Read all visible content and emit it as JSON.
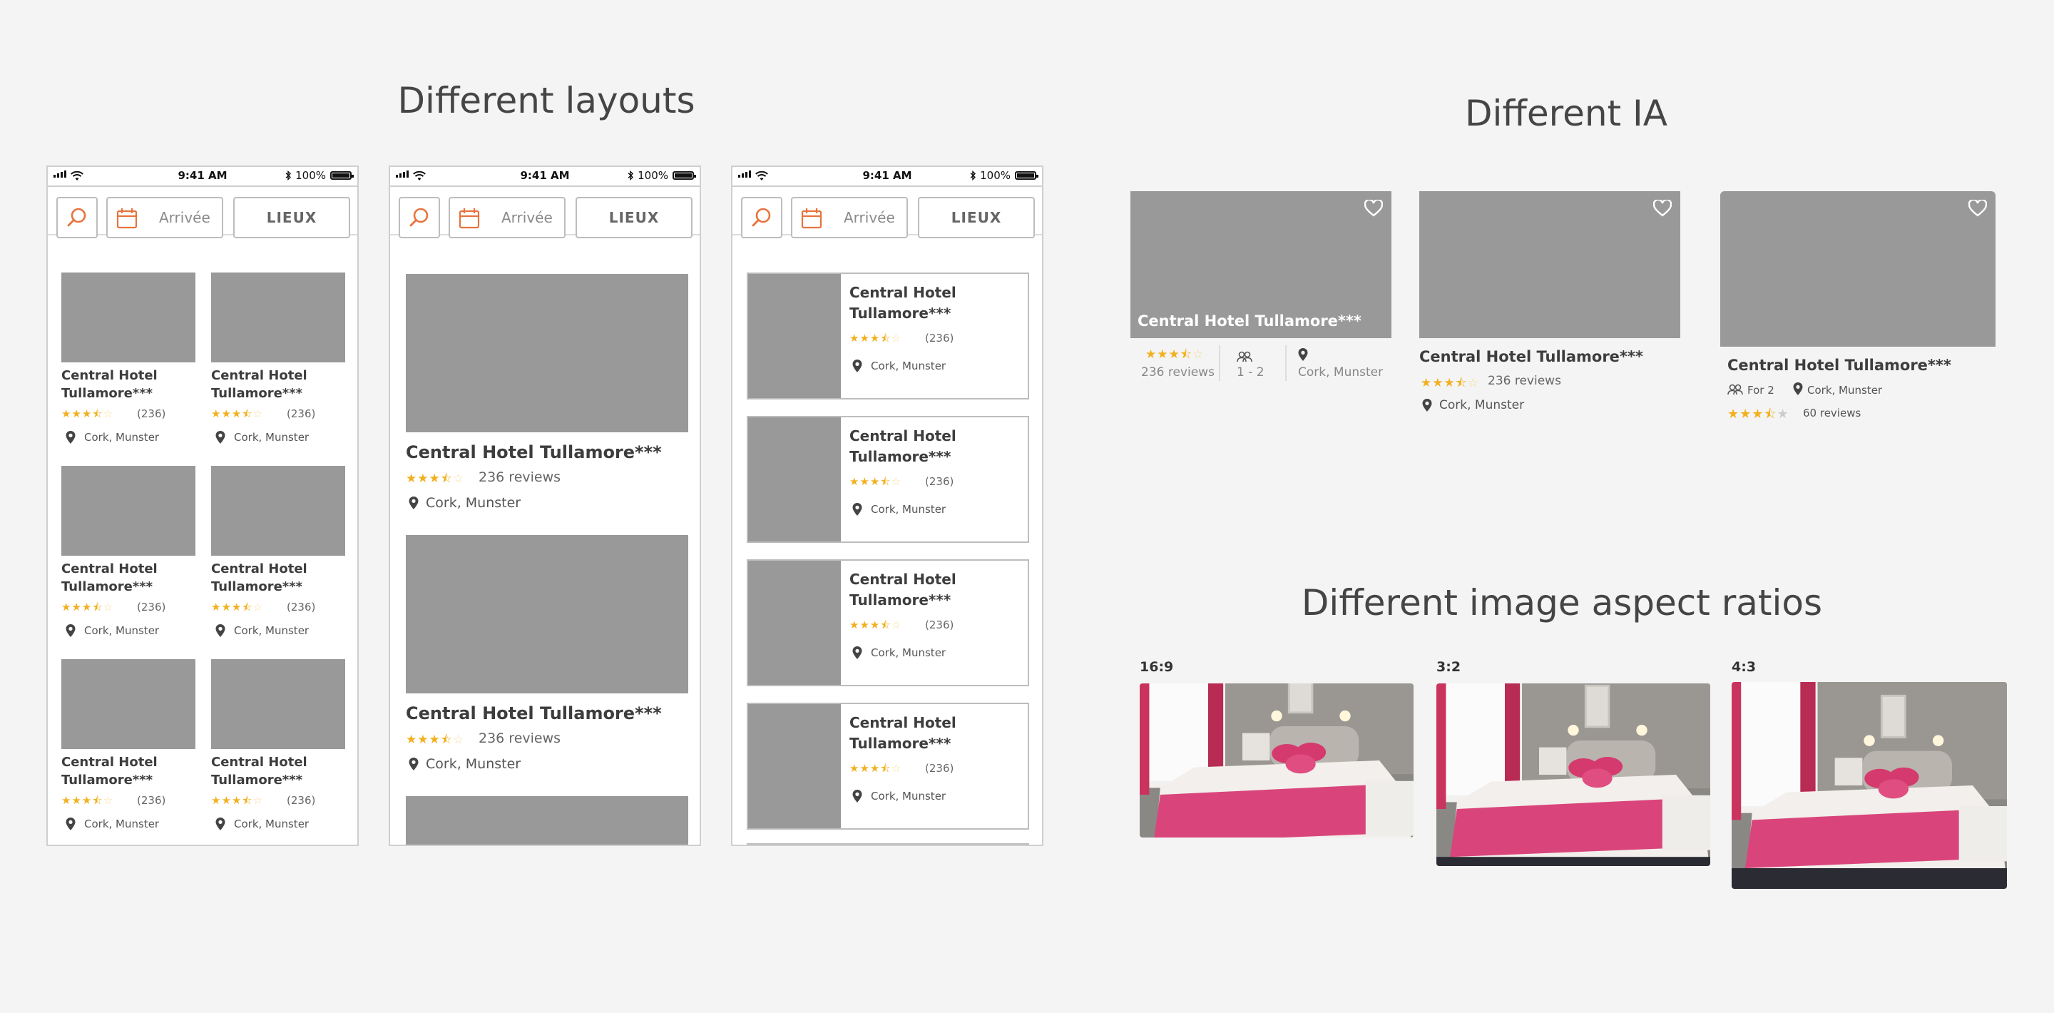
{
  "sections": {
    "layouts_title": "Different layouts",
    "ia_title": "Different IA",
    "ratios_title": "Different image aspect ratios"
  },
  "phone": {
    "time": "9:41 AM",
    "battery": "100%",
    "search_icon": "search-icon",
    "date_placeholder": "Arrivée",
    "places_button": "LIEUX"
  },
  "hotel": {
    "name": "Central Hotel Tullamore***",
    "name_line1": "Central Hotel",
    "name_line2": "Tullamore***",
    "review_count_short": "(236)",
    "reviews_long": "236 reviews",
    "location": "Cork, Munster",
    "rating": 3.5
  },
  "ia": {
    "card1": {
      "reviews": "236 reviews",
      "guests": "1 - 2",
      "location": "Cork, Munster"
    },
    "card2": {
      "reviews": "236 reviews",
      "location": "Cork, Munster"
    },
    "card3": {
      "guests": "For 2",
      "location": "Cork, Munster",
      "reviews": "60 reviews"
    }
  },
  "ratios": {
    "r1": "16:9",
    "r2": "3:2",
    "r3": "4:3"
  },
  "colors": {
    "accent": "#e7733d",
    "star": "#f2b01e",
    "placeholder": "#999999",
    "bedspread": "#d9457a"
  }
}
